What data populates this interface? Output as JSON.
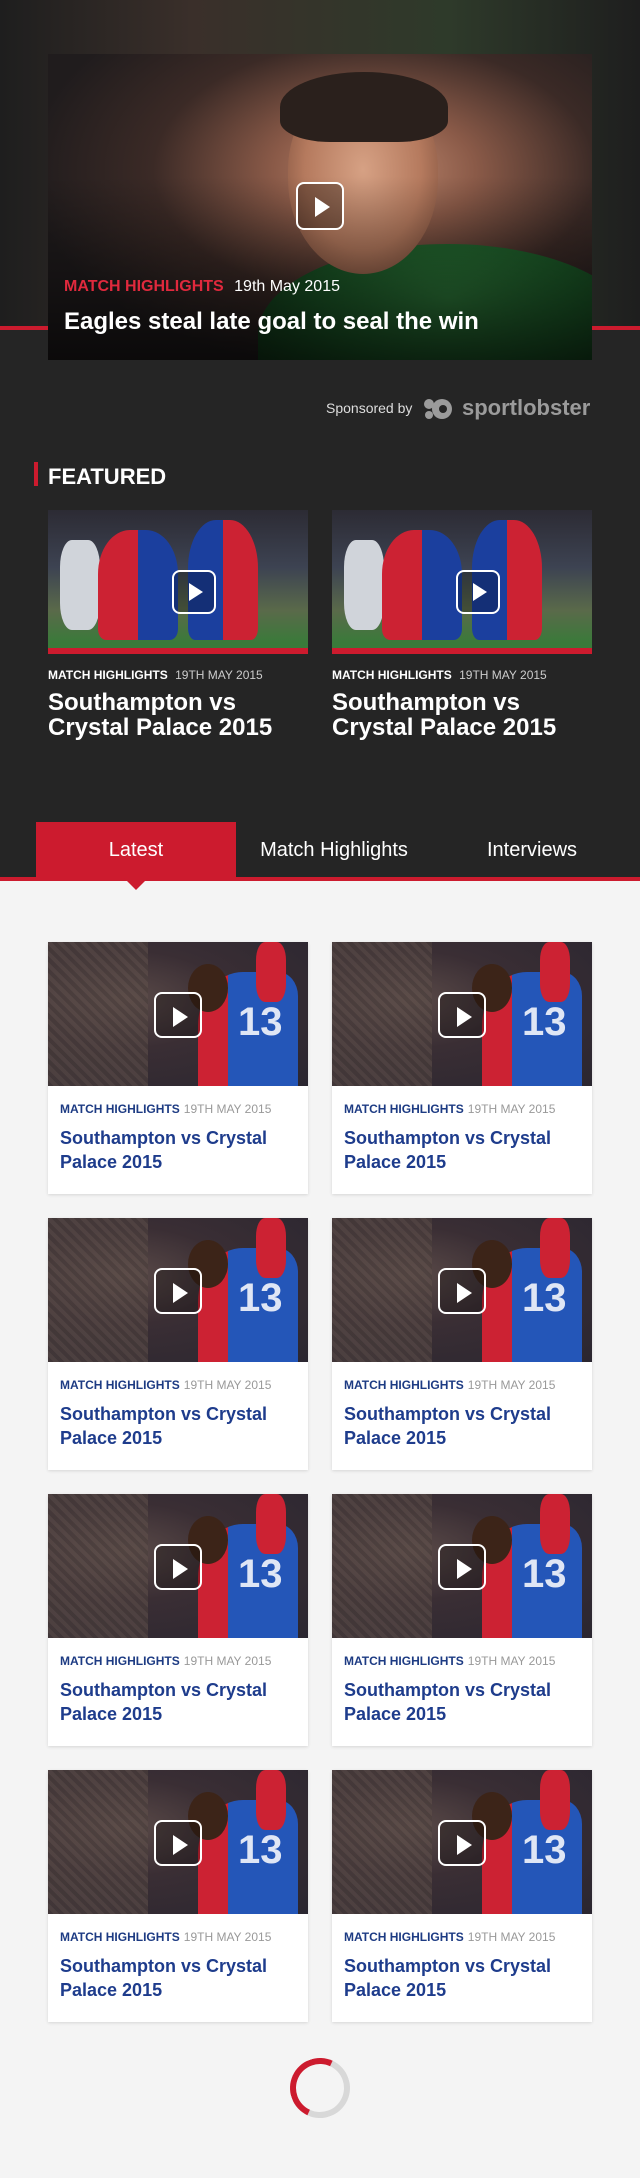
{
  "hero": {
    "category": "MATCH HIGHLIGHTS",
    "date": "19th May 2015",
    "title": "Eagles steal late goal to seal the win"
  },
  "sponsor": {
    "label": "Sponsored by",
    "brand": "sportlobster"
  },
  "featured": {
    "heading": "FEATURED",
    "items": [
      {
        "category": "MATCH HIGHLIGHTS",
        "date": "19TH MAY 2015",
        "title": "Southampton vs Crystal Palace 2015"
      },
      {
        "category": "MATCH HIGHLIGHTS",
        "date": "19TH MAY 2015",
        "title": "Southampton vs Crystal Palace 2015"
      }
    ]
  },
  "tabs": {
    "active": "Latest",
    "items": [
      "Latest",
      "Match Highlights",
      "Interviews"
    ]
  },
  "jersey_number": "13",
  "videos": [
    {
      "category": "MATCH HIGHLIGHTS",
      "date": "19TH MAY 2015",
      "title": "Southampton vs Crystal Palace 2015"
    },
    {
      "category": "MATCH HIGHLIGHTS",
      "date": "19TH MAY 2015",
      "title": "Southampton vs Crystal Palace 2015"
    },
    {
      "category": "MATCH HIGHLIGHTS",
      "date": "19TH MAY 2015",
      "title": "Southampton vs Crystal Palace 2015"
    },
    {
      "category": "MATCH HIGHLIGHTS",
      "date": "19TH MAY 2015",
      "title": "Southampton vs Crystal Palace 2015"
    },
    {
      "category": "MATCH HIGHLIGHTS",
      "date": "19TH MAY 2015",
      "title": "Southampton vs Crystal Palace 2015"
    },
    {
      "category": "MATCH HIGHLIGHTS",
      "date": "19TH MAY 2015",
      "title": "Southampton vs Crystal Palace 2015"
    },
    {
      "category": "MATCH HIGHLIGHTS",
      "date": "19TH MAY 2015",
      "title": "Southampton vs Crystal Palace 2015"
    },
    {
      "category": "MATCH HIGHLIGHTS",
      "date": "19TH MAY 2015",
      "title": "Southampton vs Crystal Palace 2015"
    }
  ],
  "colors": {
    "accent": "#cc1b2e",
    "dark_bg": "#252525",
    "link_blue": "#1e3c8c",
    "page_bg": "#f4f4f4"
  }
}
